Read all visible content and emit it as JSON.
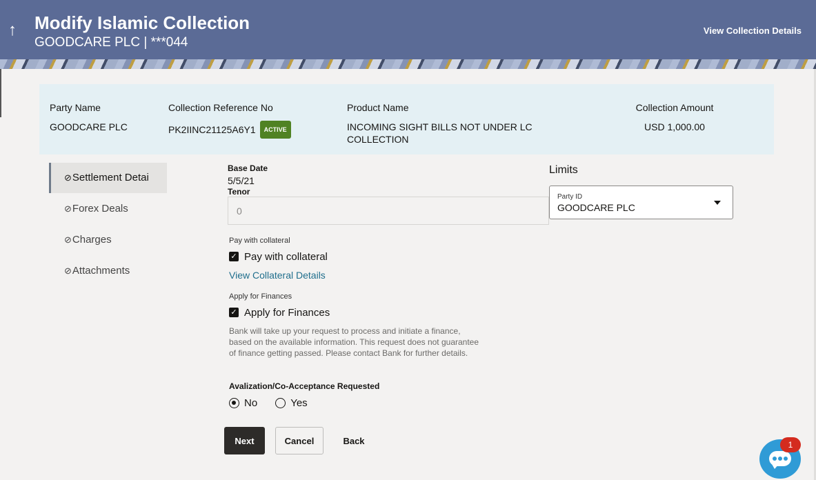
{
  "header": {
    "title": "Modify Islamic Collection",
    "subtitle": "GOODCARE PLC | ***044",
    "view_details_link": "View Collection Details",
    "back_icon": "arrow-up-icon"
  },
  "summary": {
    "party_name_label": "Party Name",
    "party_name_value": "GOODCARE PLC",
    "reference_label": "Collection Reference No",
    "reference_value": "PK2IINC21125A6Y1",
    "status_badge": "ACTIVE",
    "product_label": "Product Name",
    "product_value_line1": "INCOMING SIGHT BILLS NOT UNDER LC",
    "product_value_line2": "COLLECTION",
    "amount_label": "Collection Amount",
    "amount_value": "USD 1,000.00"
  },
  "sidenav": {
    "items": [
      {
        "label": "Settlement Detai",
        "icon": "check-circle-icon",
        "active": true
      },
      {
        "label": "Forex Deals",
        "icon": "check-circle-icon",
        "active": false
      },
      {
        "label": "Charges",
        "icon": "check-circle-icon",
        "active": false
      },
      {
        "label": "Attachments",
        "icon": "check-circle-icon",
        "active": false
      }
    ]
  },
  "form": {
    "base_date_label": "Base Date",
    "base_date_value": "5/5/21",
    "tenor_label": "Tenor",
    "tenor_placeholder": "0",
    "collateral_section_label": "Pay with collateral",
    "collateral_checkbox_label": "Pay with collateral",
    "collateral_checked": true,
    "collateral_link": "View Collateral Details",
    "finance_section_label": "Apply for Finances",
    "finance_checkbox_label": "Apply for Finances",
    "finance_checked": true,
    "finance_note": "Bank will take up your request to process and initiate a finance, based on the available information. This request does not guarantee of finance getting passed. Please contact Bank for further details.",
    "avalization_label": "Avalization/Co-Acceptance Requested",
    "avalization_options": [
      "No",
      "Yes"
    ],
    "avalization_selected": "No"
  },
  "limits": {
    "title": "Limits",
    "party_id_label": "Party ID",
    "party_id_value": "GOODCARE PLC"
  },
  "buttons": {
    "next": "Next",
    "cancel": "Cancel",
    "back": "Back"
  },
  "chat": {
    "notification_count": "1",
    "icon": "chat-bubble-icon"
  },
  "colors": {
    "header_bg": "#5b6b96",
    "summary_bg": "#e4f0f4",
    "active_badge": "#508223",
    "link": "#1f6e8c",
    "chat_bg": "#2f9bd6",
    "notification": "#d42c1f"
  }
}
